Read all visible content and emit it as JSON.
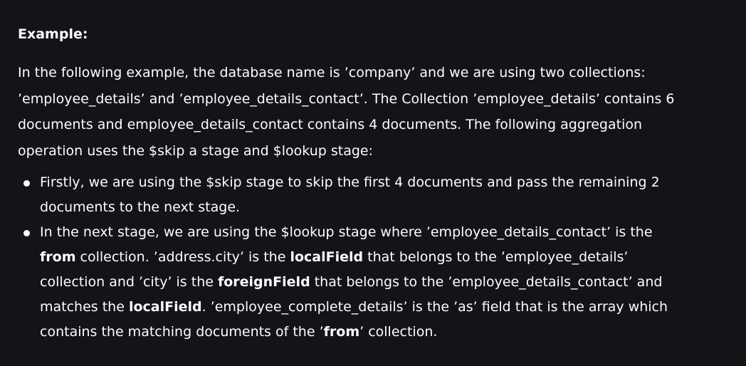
{
  "heading": "Example:",
  "intro": "In the following example, the database name is ’company’ and we are using two collections: ’employee_details’ and ’employee_details_contact’. The Collection ’employee_details’ contains 6 documents and employee_details_contact contains 4 documents. The following aggregation operation uses the $skip a stage and $lookup stage:",
  "bullets": [
    {
      "text": "Firstly, we are using the $skip stage to skip the first 4 documents and pass the remaining 2 documents to the next stage."
    },
    {
      "t1": "In the next stage, we are using the $lookup stage where  ’employee_details_contact’ is the ",
      "b1": "from",
      "t2": " collection. ’address.city’ is the ",
      "b2": "localField",
      "t3": " that belongs to the ’employee_details’ collection and ’city’ is the ",
      "b3": "foreignField",
      "t4": " that belongs to the ’employee_details_contact’ and matches the ",
      "b4": "localField",
      "t5": ". ’employee_complete_details’ is the ’as’ field that is the array which contains the matching documents of the  ’",
      "b5": "from",
      "t6": "’ collection."
    }
  ]
}
